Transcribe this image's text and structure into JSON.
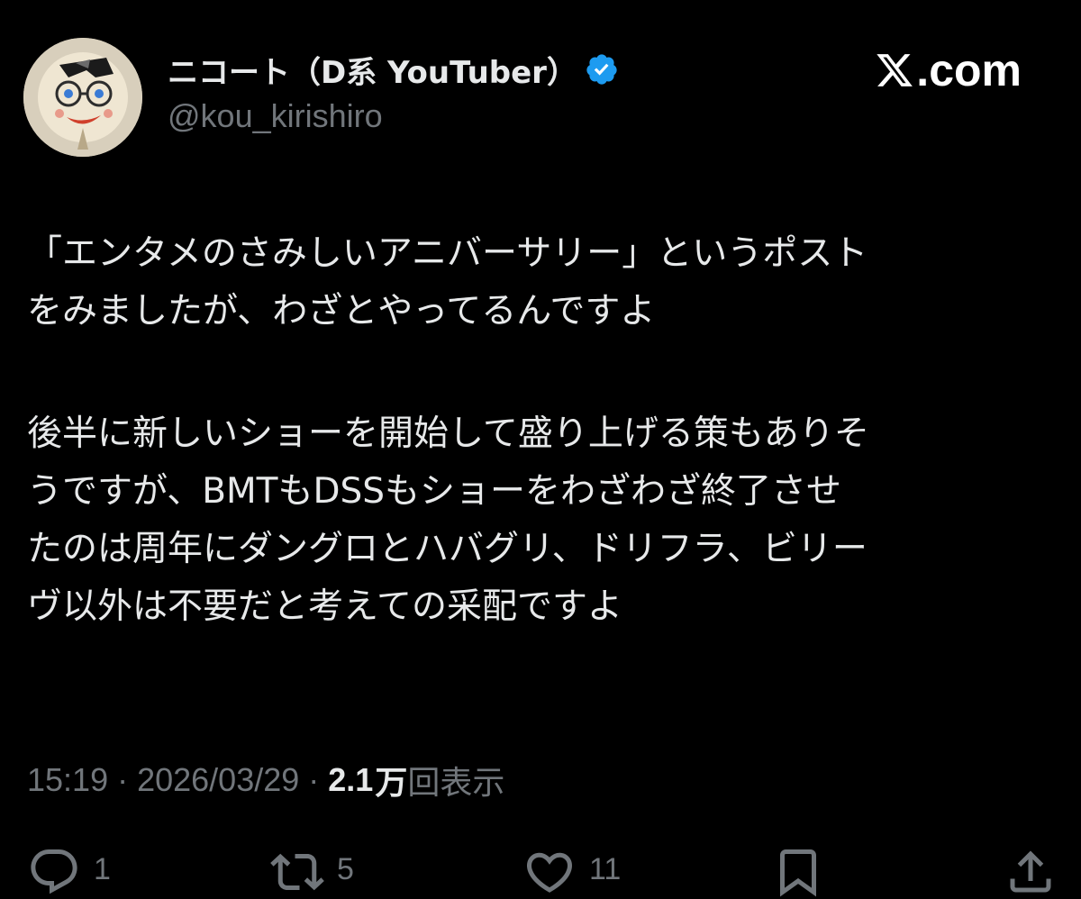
{
  "author": {
    "display_name": "ニコート（D系 YouTuber）",
    "handle": "@kou_kirishiro",
    "verified": true,
    "verified_color": "#1d9bf0"
  },
  "watermark": {
    "text": ".com"
  },
  "post": {
    "paragraphs": [
      [
        "「エンタメのさみしいアニバーサリー」というポスト",
        "をみましたが、わざとやってるんですよ"
      ],
      [
        "後半に新しいショーを開始して盛り上げる策もありそ",
        "うですが、BMTもDSSもショーをわざわざ終了させ",
        "たのは周年にダングロとハバグリ、ドリフラ、ビリー",
        "ヴ以外は不要だと考えての采配ですよ"
      ]
    ]
  },
  "meta": {
    "time": "15:19",
    "separator": "·",
    "date": "2026/03/29",
    "views_count": "2.1",
    "views_unit": "万",
    "views_label": "回表示"
  },
  "actions": {
    "reply_count": "1",
    "repost_count": "5",
    "like_count": "11",
    "icons": [
      "reply-icon",
      "repost-icon",
      "like-icon",
      "bookmark-icon",
      "share-icon"
    ]
  },
  "colors": {
    "background": "#000000",
    "text": "#e7e9ea",
    "secondary": "#71767b"
  }
}
